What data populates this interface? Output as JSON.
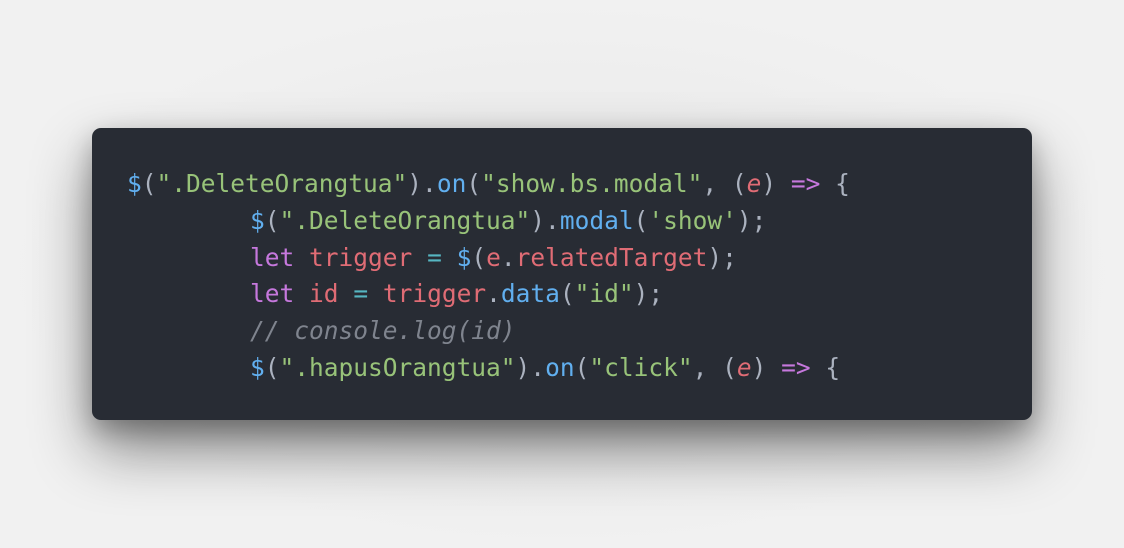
{
  "code": {
    "lines": [
      {
        "indent": false,
        "tokens": [
          {
            "t": "$",
            "c": "fn"
          },
          {
            "t": "(",
            "c": "plain"
          },
          {
            "t": "\".DeleteOrangtua\"",
            "c": "str"
          },
          {
            "t": ").",
            "c": "plain"
          },
          {
            "t": "on",
            "c": "fn"
          },
          {
            "t": "(",
            "c": "plain"
          },
          {
            "t": "\"show.bs.modal\"",
            "c": "str"
          },
          {
            "t": ", (",
            "c": "plain"
          },
          {
            "t": "e",
            "c": "param"
          },
          {
            "t": ") ",
            "c": "plain"
          },
          {
            "t": "=>",
            "c": "op"
          },
          {
            "t": " {",
            "c": "plain"
          }
        ]
      },
      {
        "indent": true,
        "tokens": [
          {
            "t": "$",
            "c": "fn"
          },
          {
            "t": "(",
            "c": "plain"
          },
          {
            "t": "\".DeleteOrangtua\"",
            "c": "str"
          },
          {
            "t": ").",
            "c": "plain"
          },
          {
            "t": "modal",
            "c": "fn"
          },
          {
            "t": "(",
            "c": "plain"
          },
          {
            "t": "'show'",
            "c": "str"
          },
          {
            "t": ");",
            "c": "plain"
          }
        ]
      },
      {
        "indent": true,
        "tokens": [
          {
            "t": "let",
            "c": "kw"
          },
          {
            "t": " ",
            "c": "plain"
          },
          {
            "t": "trigger",
            "c": "var"
          },
          {
            "t": " ",
            "c": "plain"
          },
          {
            "t": "=",
            "c": "op2"
          },
          {
            "t": " ",
            "c": "plain"
          },
          {
            "t": "$",
            "c": "fn"
          },
          {
            "t": "(",
            "c": "plain"
          },
          {
            "t": "e",
            "c": "var"
          },
          {
            "t": ".",
            "c": "plain"
          },
          {
            "t": "relatedTarget",
            "c": "var"
          },
          {
            "t": ");",
            "c": "plain"
          }
        ]
      },
      {
        "indent": true,
        "tokens": [
          {
            "t": "let",
            "c": "kw"
          },
          {
            "t": " ",
            "c": "plain"
          },
          {
            "t": "id",
            "c": "var"
          },
          {
            "t": " ",
            "c": "plain"
          },
          {
            "t": "=",
            "c": "op2"
          },
          {
            "t": " ",
            "c": "plain"
          },
          {
            "t": "trigger",
            "c": "var"
          },
          {
            "t": ".",
            "c": "plain"
          },
          {
            "t": "data",
            "c": "fn"
          },
          {
            "t": "(",
            "c": "plain"
          },
          {
            "t": "\"id\"",
            "c": "str"
          },
          {
            "t": ");",
            "c": "plain"
          }
        ]
      },
      {
        "indent": true,
        "tokens": [
          {
            "t": "// console.log(id)",
            "c": "comment"
          }
        ]
      },
      {
        "indent": true,
        "tokens": [
          {
            "t": "$",
            "c": "fn"
          },
          {
            "t": "(",
            "c": "plain"
          },
          {
            "t": "\".hapusOrangtua\"",
            "c": "str"
          },
          {
            "t": ").",
            "c": "plain"
          },
          {
            "t": "on",
            "c": "fn"
          },
          {
            "t": "(",
            "c": "plain"
          },
          {
            "t": "\"click\"",
            "c": "str"
          },
          {
            "t": ", (",
            "c": "plain"
          },
          {
            "t": "e",
            "c": "param"
          },
          {
            "t": ") ",
            "c": "plain"
          },
          {
            "t": "=>",
            "c": "op"
          },
          {
            "t": " {",
            "c": "plain"
          }
        ]
      }
    ]
  },
  "colors": {
    "background": "#efefef",
    "card": "#282c34",
    "plain": "#abb2bf",
    "function": "#61afef",
    "string": "#98c379",
    "keyword": "#c678dd",
    "variable": "#e06c75",
    "comment": "#7f848e"
  }
}
